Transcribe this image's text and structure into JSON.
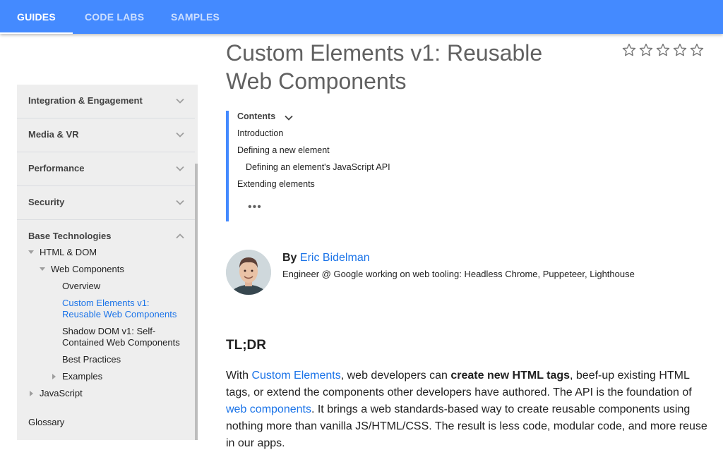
{
  "topbar": {
    "tabs": [
      {
        "label": "GUIDES",
        "active": true
      },
      {
        "label": "CODE LABS",
        "active": false
      },
      {
        "label": "SAMPLES",
        "active": false
      }
    ]
  },
  "sidebar": {
    "sections": [
      {
        "label": "Integration & Engagement",
        "expanded": false
      },
      {
        "label": "Media & VR",
        "expanded": false
      },
      {
        "label": "Performance",
        "expanded": false
      },
      {
        "label": "Security",
        "expanded": false
      },
      {
        "label": "Base Technologies",
        "expanded": true
      }
    ],
    "tree": {
      "html_dom": "HTML & DOM",
      "web_components": "Web Components",
      "overview": "Overview",
      "custom_elements_line1": "Custom Elements v1:",
      "custom_elements_line2": "Reusable Web Components",
      "shadow_dom_line1": "Shadow DOM v1: Self-",
      "shadow_dom_line2": "Contained Web Components",
      "best_practices": "Best Practices",
      "examples": "Examples",
      "javascript": "JavaScript"
    },
    "glossary": "Glossary"
  },
  "article": {
    "title_line1": "Custom Elements v1: Reusable",
    "title_line2": "Web Components",
    "rating": {
      "max": 5,
      "filled": 0
    },
    "toc": {
      "header": "Contents",
      "items": [
        "Introduction",
        "Defining a new element",
        "Defining an element's JavaScript API",
        "Extending elements"
      ],
      "more": "•••"
    },
    "author": {
      "by": "By",
      "name": "Eric Bidelman",
      "bio": "Engineer @ Google working on web tooling: Headless Chrome, Puppeteer, Lighthouse"
    },
    "tldr_heading": "TL;DR",
    "paragraph": {
      "p1": "With ",
      "link1": "Custom Elements",
      "p2": ", web developers can ",
      "bold1": "create new HTML tags",
      "p3": ", beef-up existing HTML tags, or extend the components other developers have authored. The API is the foundation of ",
      "link2": "web components",
      "p4": ". It brings a web standards-based way to create reusable components using nothing more than vanilla JS/HTML/CSS. The result is less code, modular code, and more reuse in our apps."
    }
  },
  "colors": {
    "topbar": "#448aff",
    "link": "#1a73e8",
    "toc_border": "#448aff",
    "sidebar_bg": "#eeeeee"
  }
}
